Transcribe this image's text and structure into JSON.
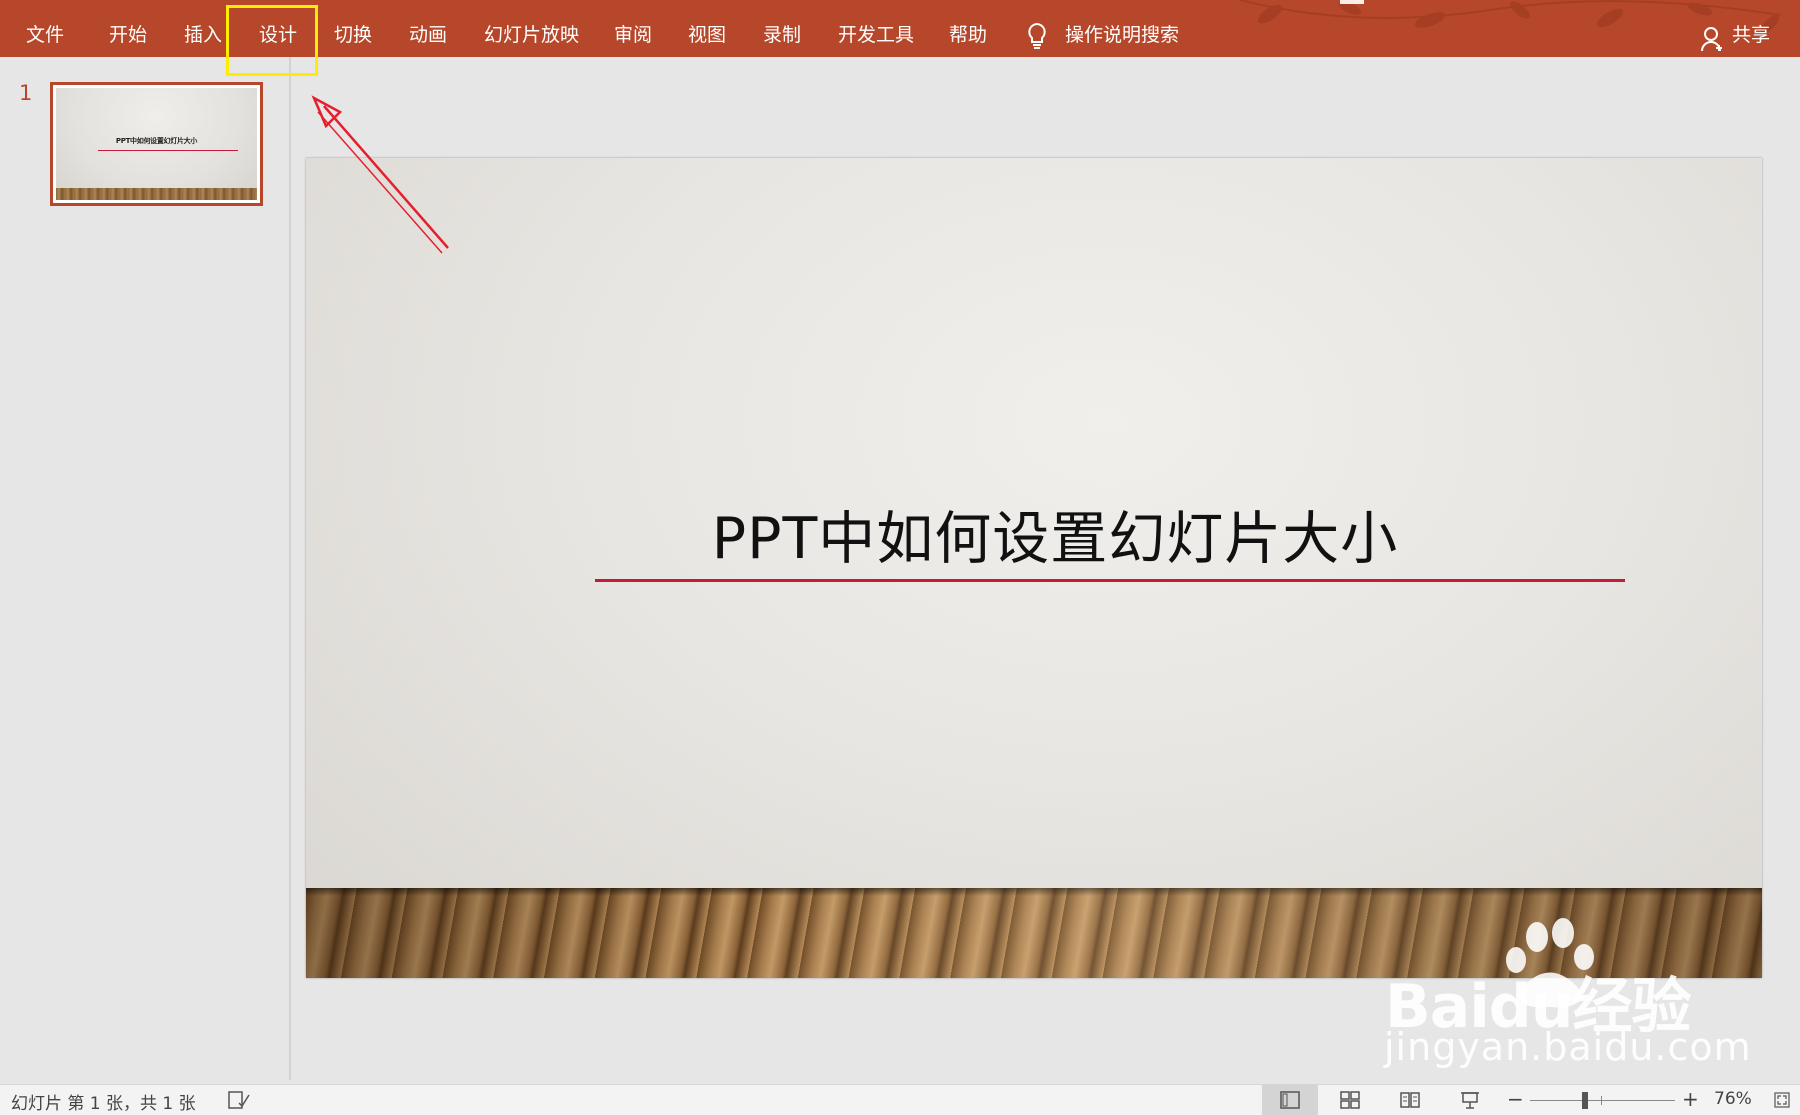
{
  "ribbon": {
    "tabs": [
      {
        "label": "文件"
      },
      {
        "label": "开始"
      },
      {
        "label": "插入"
      },
      {
        "label": "设计"
      },
      {
        "label": "切换"
      },
      {
        "label": "动画"
      },
      {
        "label": "幻灯片放映"
      },
      {
        "label": "审阅"
      },
      {
        "label": "视图"
      },
      {
        "label": "录制"
      },
      {
        "label": "开发工具"
      },
      {
        "label": "帮助"
      }
    ],
    "tell_me": "操作说明搜索",
    "tell_me_icon": "lightbulb-icon",
    "share": "共享",
    "share_icon": "person-icon",
    "highlighted_tab": "设计",
    "accent_color": "#b7472a",
    "highlight_color": "#ffec00"
  },
  "thumbnails": [
    {
      "number": "1",
      "title": "PPT中如何设置幻灯片大小",
      "selected": true
    }
  ],
  "slide": {
    "title": "PPT中如何设置幻灯片大小",
    "rule_color": "#c21c3b"
  },
  "statusbar": {
    "slide_count": "幻灯片 第 1 张，共 1 张",
    "notes_icon": "notes-icon",
    "views": [
      "normal-view-icon",
      "slide-sorter-icon",
      "reading-view-icon",
      "slideshow-icon"
    ],
    "zoom_minus": "−",
    "zoom_plus": "+",
    "zoom_level": "76%",
    "zoom_fraction": 0.38,
    "fit_icon": "fit-to-window-icon"
  },
  "watermark": {
    "brand": "Baidu经验",
    "url": "jingyan.baidu.com"
  }
}
